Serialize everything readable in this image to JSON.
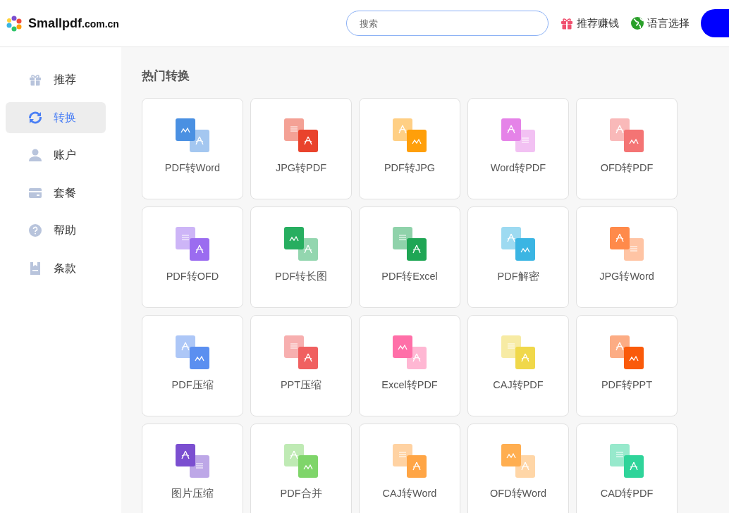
{
  "header": {
    "logo_main": "Smallpdf",
    "logo_suffix": ".com.cn",
    "search": {
      "placeholder": "搜索"
    },
    "links": [
      {
        "label": "推荐赚钱",
        "kind": "gift"
      },
      {
        "label": "语言选择",
        "kind": "globe"
      }
    ]
  },
  "sidebar": {
    "items": [
      {
        "label": "推荐",
        "kind": "gift",
        "selected": false
      },
      {
        "label": "转换",
        "kind": "convert",
        "selected": true
      },
      {
        "label": "账户",
        "kind": "user",
        "selected": false
      },
      {
        "label": "套餐",
        "kind": "card",
        "selected": false
      },
      {
        "label": "帮助",
        "kind": "help",
        "selected": false
      },
      {
        "label": "条款",
        "kind": "terms",
        "selected": false
      }
    ]
  },
  "section_title": "热门转换",
  "tools": [
    {
      "label": "PDF转Word",
      "color": "#4a90e2"
    },
    {
      "label": "JPG转PDF",
      "color": "#e9432c"
    },
    {
      "label": "PDF转JPG",
      "color": "#ff9f0a"
    },
    {
      "label": "Word转PDF",
      "color": "#e583e8"
    },
    {
      "label": "OFD转PDF",
      "color": "#f47474"
    },
    {
      "label": "PDF转OFD",
      "color": "#9b6cf0"
    },
    {
      "label": "PDF转长图",
      "color": "#27ae60"
    },
    {
      "label": "PDF转Excel",
      "color": "#1fa655"
    },
    {
      "label": "PDF解密",
      "color": "#3bb5e3"
    },
    {
      "label": "JPG转Word",
      "color": "#ff8a4a"
    },
    {
      "label": "PDF压缩",
      "color": "#5b8ff0"
    },
    {
      "label": "PPT压缩",
      "color": "#f06060"
    },
    {
      "label": "Excel转PDF",
      "color": "#ff6fa8"
    },
    {
      "label": "CAJ转PDF",
      "color": "#f0d84a"
    },
    {
      "label": "PDF转PPT",
      "color": "#fa5a0a"
    },
    {
      "label": "图片压缩",
      "color": "#7b4fd0"
    },
    {
      "label": "PDF合并",
      "color": "#7fd56a"
    },
    {
      "label": "CAJ转Word",
      "color": "#ffa545"
    },
    {
      "label": "OFD转Word",
      "color": "#ffae50"
    },
    {
      "label": "CAD转PDF",
      "color": "#2fd49a"
    }
  ]
}
